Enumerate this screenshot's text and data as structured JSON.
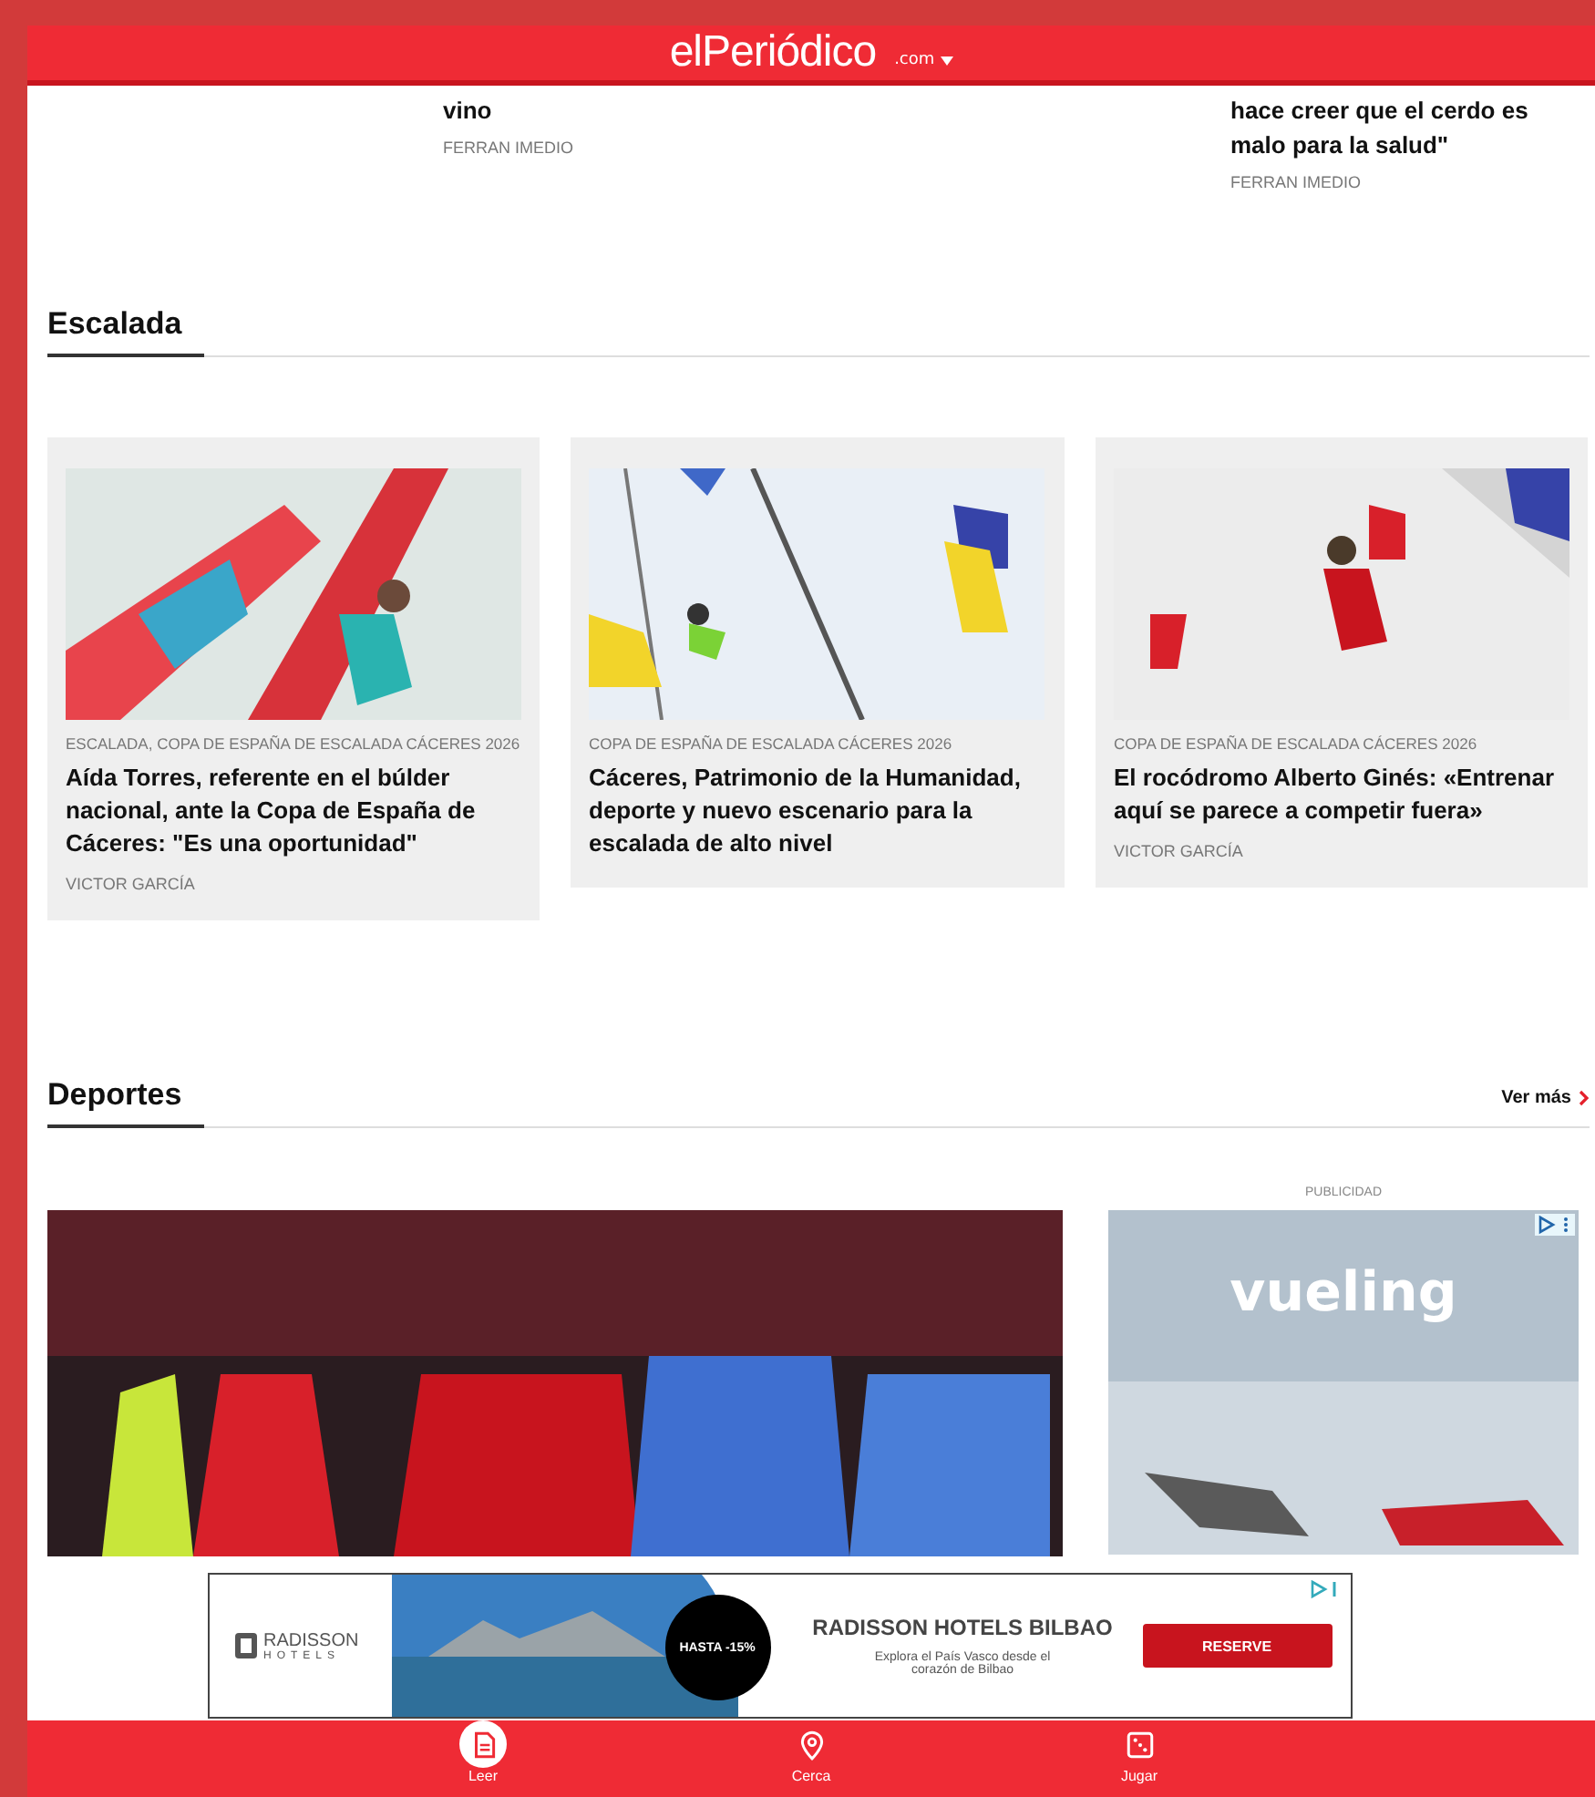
{
  "header": {
    "logo": "elPeriódico",
    "edition": ".com"
  },
  "top_stories": [
    {
      "title_tail": "vino",
      "author": "FERRAN IMEDIO"
    },
    {
      "title_tail": "hace creer que el cerdo es malo para la salud\"",
      "author": "FERRAN IMEDIO"
    }
  ],
  "escalada": {
    "title": "Escalada",
    "cards": [
      {
        "kicker": "ESCALADA, COPA DE ESPAÑA DE ESCALADA CÁCERES 2026",
        "title": "Aída Torres, referente en el búlder nacional, ante la Copa de España de Cáceres: \"Es una oportunidad\"",
        "author": "VICTOR GARCÍA"
      },
      {
        "kicker": "COPA DE ESPAÑA DE ESCALADA CÁCERES 2026",
        "title": "Cáceres, Patrimonio de la Humanidad, deporte y nuevo escenario para la escalada de alto nivel"
      },
      {
        "kicker": "COPA DE ESPAÑA DE ESCALADA CÁCERES 2026",
        "title": "El rocódromo Alberto Ginés: «Entrenar aquí se parece a competir fuera»",
        "author": "VICTOR GARCÍA"
      }
    ]
  },
  "deportes": {
    "title": "Deportes",
    "more": "Ver más",
    "ad_label": "PUBLICIDAD",
    "ad_brand": "vueling"
  },
  "banner_ad": {
    "brand": "RADISSON",
    "brand_sub": "HOTELS",
    "badge": "HASTA -15%",
    "headline": "RADISSON HOTELS BILBAO",
    "text": "Explora el País Vasco desde el corazón de Bilbao",
    "button": "RESERVE"
  },
  "bottom_nav": [
    {
      "label": "Leer",
      "selected": true
    },
    {
      "label": "Cerca",
      "selected": false
    },
    {
      "label": "Jugar",
      "selected": false
    }
  ]
}
